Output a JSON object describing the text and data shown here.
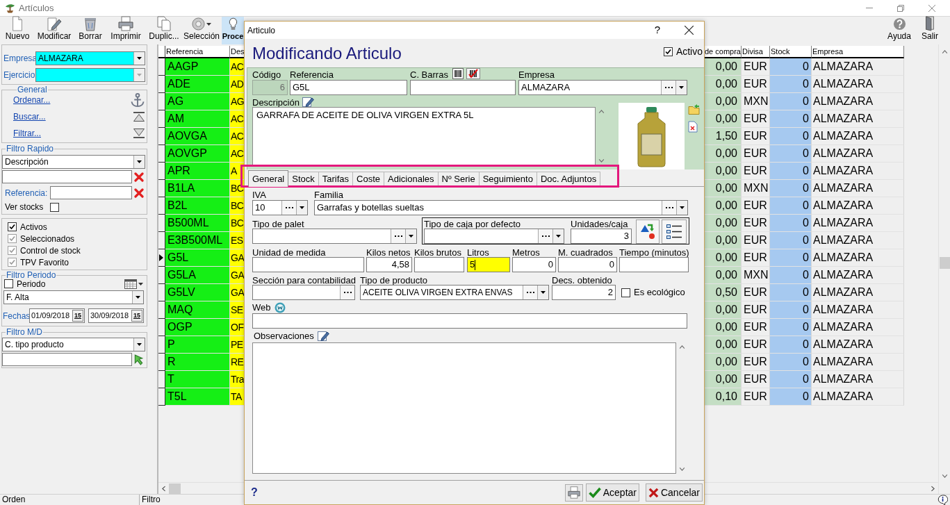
{
  "window": {
    "title": "Artículos"
  },
  "toolbar": {
    "buttons": [
      {
        "label": "Nuevo",
        "highlighted": false
      },
      {
        "label": "Modificar",
        "highlighted": false
      },
      {
        "label": "Borrar",
        "highlighted": false
      },
      {
        "label": "Imprimir",
        "highlighted": false
      },
      {
        "label": "Duplic...",
        "highlighted": false
      },
      {
        "label": "Selección",
        "highlighted": false
      },
      {
        "label": "Proce",
        "highlighted": true
      }
    ],
    "right_buttons": [
      {
        "label": "Ayuda"
      },
      {
        "label": "Salir"
      }
    ]
  },
  "left_panel": {
    "company": {
      "label": "Empresa",
      "value": "ALMAZARA"
    },
    "year": {
      "label": "Ejercicio",
      "disabled": true
    },
    "general": {
      "title": "General",
      "links": [
        "Ordenar...",
        "Buscar...",
        "Filtrar..."
      ]
    },
    "quick_filter": {
      "title": "Filtro Rapido",
      "field": "Descripción",
      "reference_label": "Referencia:",
      "stocks": {
        "label": "Ver stocks",
        "checked": false
      }
    },
    "flags": [
      {
        "label": "Activos",
        "checked": true,
        "disabled": false
      },
      {
        "label": "Seleccionados",
        "checked": true,
        "disabled": true
      },
      {
        "label": "Control de stock",
        "checked": true,
        "disabled": true
      },
      {
        "label": "TPV Favorito",
        "checked": true,
        "disabled": true
      }
    ],
    "period_filter": {
      "title": "Filtro Periodo",
      "period": {
        "label": "Periodo",
        "checked": false
      },
      "date_field": "F. Alta",
      "dates_label": "Fechas",
      "from": {
        "value": "01/09/2018",
        "button": "15"
      },
      "to": {
        "value": "30/09/2018",
        "button": "15"
      }
    },
    "md_filter": {
      "title": "Filtro M/D",
      "field": "C. tipo producto"
    }
  },
  "grid": {
    "columns": [
      "Referencia",
      "Des",
      "de compra",
      "Divisa",
      "Stock",
      "Empresa"
    ],
    "rows": [
      {
        "selected": false,
        "cells": [
          "AAGP",
          "AC",
          "0,00",
          "EUR",
          "0",
          "ALMAZARA"
        ]
      },
      {
        "selected": false,
        "cells": [
          "ADE",
          "AD",
          "0,00",
          "EUR",
          "0",
          "ALMAZARA"
        ]
      },
      {
        "selected": false,
        "cells": [
          "AG",
          "AG",
          "0,00",
          "MXN",
          "0",
          "ALMAZARA"
        ]
      },
      {
        "selected": false,
        "cells": [
          "AM",
          "AC",
          "0,00",
          "EUR",
          "0",
          "ALMAZARA"
        ]
      },
      {
        "selected": false,
        "cells": [
          "AOVGA",
          "AC",
          "1,50",
          "EUR",
          "0",
          "ALMAZARA"
        ]
      },
      {
        "selected": false,
        "cells": [
          "AOVGP",
          "AC",
          "0,00",
          "EUR",
          "0",
          "ALMAZARA"
        ]
      },
      {
        "selected": false,
        "cells": [
          "APR",
          "A",
          "0,00",
          "EUR",
          "0",
          "ALMAZARA"
        ]
      },
      {
        "selected": false,
        "cells": [
          "B1LA",
          "BC",
          "0,00",
          "MXN",
          "0",
          "ALMAZARA"
        ]
      },
      {
        "selected": false,
        "cells": [
          "B2L",
          "BC",
          "0,00",
          "EUR",
          "0",
          "ALMAZARA"
        ]
      },
      {
        "selected": false,
        "cells": [
          "B500ML",
          "BC",
          "0,00",
          "EUR",
          "0",
          "ALMAZARA"
        ]
      },
      {
        "selected": false,
        "cells": [
          "E3B500ML",
          "ES",
          "0,00",
          "EUR",
          "0",
          "ALMAZARA"
        ]
      },
      {
        "selected": true,
        "cells": [
          "G5L",
          "GA",
          "0,00",
          "EUR",
          "0",
          "ALMAZARA"
        ]
      },
      {
        "selected": false,
        "cells": [
          "G5LA",
          "GA",
          "0,00",
          "MXN",
          "0",
          "ALMAZARA"
        ]
      },
      {
        "selected": false,
        "cells": [
          "G5LV",
          "GA",
          "0,50",
          "EUR",
          "0",
          "ALMAZARA"
        ]
      },
      {
        "selected": false,
        "cells": [
          "MAQ",
          "SE",
          "0,00",
          "EUR",
          "0",
          "ALMAZARA"
        ]
      },
      {
        "selected": false,
        "cells": [
          "OGP",
          "OF",
          "0,00",
          "EUR",
          "0",
          "ALMAZARA"
        ]
      },
      {
        "selected": false,
        "cells": [
          "P",
          "PE",
          "0,00",
          "EUR",
          "0",
          "ALMAZARA"
        ]
      },
      {
        "selected": false,
        "cells": [
          "R",
          "RE",
          "0,00",
          "EUR",
          "0",
          "ALMAZARA"
        ]
      },
      {
        "selected": false,
        "cells": [
          "T",
          "Tra",
          "0,00",
          "EUR",
          "0",
          "ALMAZARA"
        ]
      },
      {
        "selected": false,
        "cells": [
          "T5L",
          "TA",
          "0,10",
          "EUR",
          "0",
          "ALMAZARA"
        ]
      }
    ]
  },
  "dialog": {
    "title": "Articulo",
    "help": "?",
    "heading": "Modificando Articulo",
    "active": {
      "label": "Activo",
      "checked": true
    },
    "code": {
      "label": "Código",
      "value": "6",
      "disabled": true
    },
    "reference": {
      "label": "Referencia",
      "value": "G5L"
    },
    "barcode": {
      "label": "C. Barras"
    },
    "company": {
      "label": "Empresa",
      "value": "ALMAZARA"
    },
    "description": {
      "label": "Descripción",
      "value": "GARRAFA DE ACEITE DE OLIVA VIRGEN EXTRA 5L"
    },
    "tabs": [
      {
        "label": "General",
        "selected": true
      },
      {
        "label": "Stock",
        "selected": false
      },
      {
        "label": "Tarifas",
        "selected": false
      },
      {
        "label": "Coste",
        "selected": false
      },
      {
        "label": "Adicionales",
        "selected": false
      },
      {
        "label": "Nº Serie",
        "selected": false
      },
      {
        "label": "Seguimiento",
        "selected": false
      },
      {
        "label": "Doc. Adjuntos",
        "selected": false
      }
    ],
    "general_tab": {
      "iva": {
        "label": "IVA",
        "value": "10"
      },
      "family": {
        "label": "Familia",
        "value": "Garrafas y botellas sueltas"
      },
      "pallet_type": {
        "label": "Tipo de palet"
      },
      "box_type": {
        "label": "Tipo de caja por defecto"
      },
      "units_per_box": {
        "label": "Unidades/caja",
        "value": "3"
      },
      "measures": [
        {
          "label": "Unidad de medida",
          "focused": false
        },
        {
          "label": "Kilos netos",
          "value": "4,58",
          "focused": false
        },
        {
          "label": "Kilos brutos",
          "focused": false
        },
        {
          "label": "Litros",
          "value": "5",
          "focused": true
        },
        {
          "label": "Metros",
          "value": "0",
          "focused": false
        },
        {
          "label": "M. cuadrados",
          "value": "0",
          "focused": false
        },
        {
          "label": "Tiempo (minutos)",
          "focused": false
        }
      ],
      "accounting_section": {
        "label": "Sección para contabilidad"
      },
      "product_type": {
        "label": "Tipo de producto",
        "value": "ACEITE OLIVA VIRGEN EXTRA ENVAS"
      },
      "decimals": {
        "label": "Decs. obtenido",
        "value": "2"
      },
      "organic": {
        "label": "Es ecológico",
        "checked": false
      },
      "web": {
        "label": "Web"
      },
      "notes": {
        "label": "Observaciones"
      }
    },
    "footer": {
      "help": "?",
      "buttons": [
        {
          "label": "Aceptar",
          "kind": "accept"
        },
        {
          "label": "Cancelar",
          "kind": "cancel"
        }
      ]
    }
  },
  "status_bar": {
    "panels": [
      "Orden",
      "Filtro"
    ]
  }
}
